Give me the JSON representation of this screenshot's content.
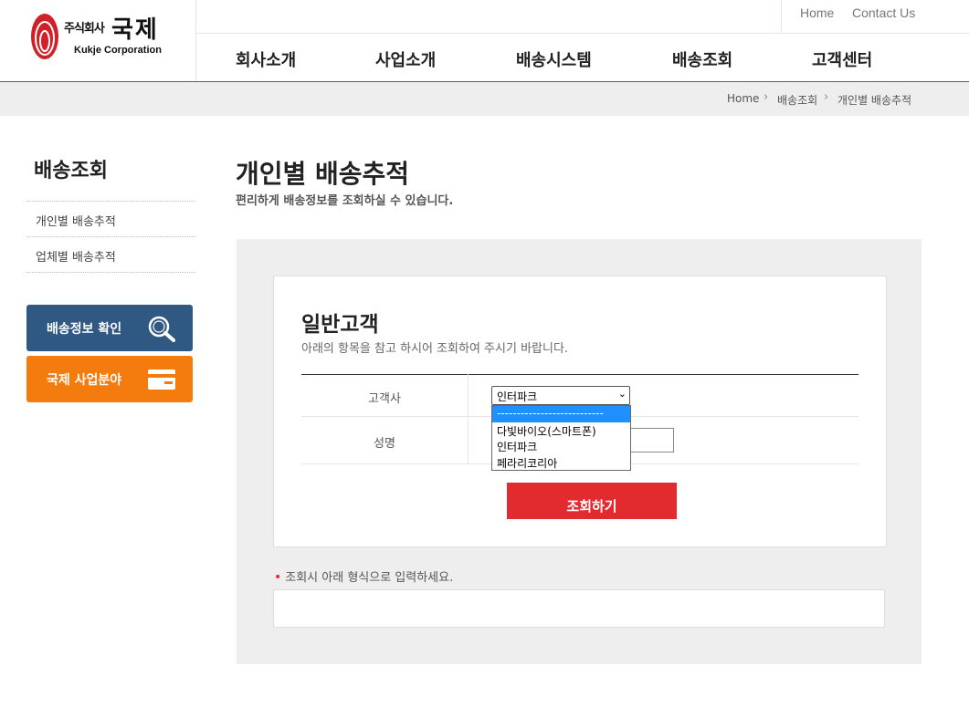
{
  "header": {
    "logo": {
      "ko_small": "주식회사",
      "ko_big": "국제",
      "en": "Kukje Corporation"
    },
    "util": {
      "home": "Home",
      "contact": "Contact Us"
    },
    "gnb": [
      "회사소개",
      "사업소개",
      "배송시스템",
      "배송조회",
      "고객센터"
    ]
  },
  "breadcrumb": [
    "Home",
    "배송조회",
    "개인별 배송추적"
  ],
  "sidebar": {
    "title": "배송조회",
    "items": [
      "개인별 배송추적",
      "업체별 배송추적"
    ],
    "buttons": [
      {
        "label": "배송정보 확인",
        "icon": "search-icon",
        "color": "#2f5883"
      },
      {
        "label": "국제 사업분야",
        "icon": "card-icon",
        "color": "#f47c0e"
      }
    ]
  },
  "main": {
    "title": "개인별 배송추적",
    "desc": "편리하게 배송정보를 조회하실 수 있습니다.",
    "card": {
      "title": "일반고객",
      "desc": "아래의 항목을 참고 하시어 조회하여 주시기 바랍니다.",
      "fields": {
        "company_label": "고객사",
        "name_label": "성명",
        "company_selected": "인터파크",
        "company_options": [
          "---------------------------",
          "다빛바이오(스마트폰)",
          "인터파크",
          "페라리코리아"
        ]
      },
      "submit": "조회하기"
    },
    "note": "조회시 아래 형식으로 입력하세요."
  },
  "colors": {
    "accent_red": "#e22b2f",
    "header_line": "#c0392b",
    "blue_button": "#2f5883",
    "orange_button": "#f47c0e",
    "highlight": "#1e90ff"
  }
}
